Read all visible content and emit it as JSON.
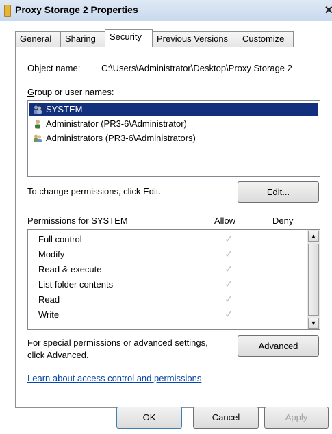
{
  "window": {
    "title": "Proxy Storage 2 Properties",
    "close_glyph": "✕"
  },
  "tabs": [
    {
      "label": "General"
    },
    {
      "label": "Sharing"
    },
    {
      "label": "Security"
    },
    {
      "label": "Previous Versions"
    },
    {
      "label": "Customize"
    }
  ],
  "security": {
    "object_name_label": "Object name:",
    "object_name_value": "C:\\Users\\Administrator\\Desktop\\Proxy Storage 2",
    "group_label_accesskey": "G",
    "group_label_rest": "roup or user names:",
    "users": [
      {
        "name": "SYSTEM",
        "icon": "system-group-icon"
      },
      {
        "name": "Administrator (PR3-6\\Administrator)",
        "icon": "user-icon"
      },
      {
        "name": "Administrators (PR3-6\\Administrators)",
        "icon": "group-icon"
      }
    ],
    "change_hint": "To change permissions, click Edit.",
    "edit_button_accesskey": "E",
    "edit_button_rest": "dit...",
    "permissions_label_accesskey": "P",
    "permissions_label_rest": "ermissions for SYSTEM",
    "allow_header": "Allow",
    "deny_header": "Deny",
    "permissions": [
      {
        "name": "Full control",
        "allow": "✓",
        "deny": ""
      },
      {
        "name": "Modify",
        "allow": "✓",
        "deny": ""
      },
      {
        "name": "Read & execute",
        "allow": "✓",
        "deny": ""
      },
      {
        "name": "List folder contents",
        "allow": "✓",
        "deny": ""
      },
      {
        "name": "Read",
        "allow": "✓",
        "deny": ""
      },
      {
        "name": "Write",
        "allow": "✓",
        "deny": ""
      }
    ],
    "advanced_hint_line1": "For special permissions or advanced settings,",
    "advanced_hint_line2": "click Advanced.",
    "advanced_button_pre": "Ad",
    "advanced_button_accesskey": "v",
    "advanced_button_post": "anced",
    "learn_link": "Learn about access control and permissions"
  },
  "footer": {
    "ok_label": "OK",
    "cancel_label": "Cancel",
    "apply_label": "Apply"
  },
  "colors": {
    "selection": "#12307c",
    "link": "#0645ad",
    "disabled_text": "#a0a0a0"
  }
}
